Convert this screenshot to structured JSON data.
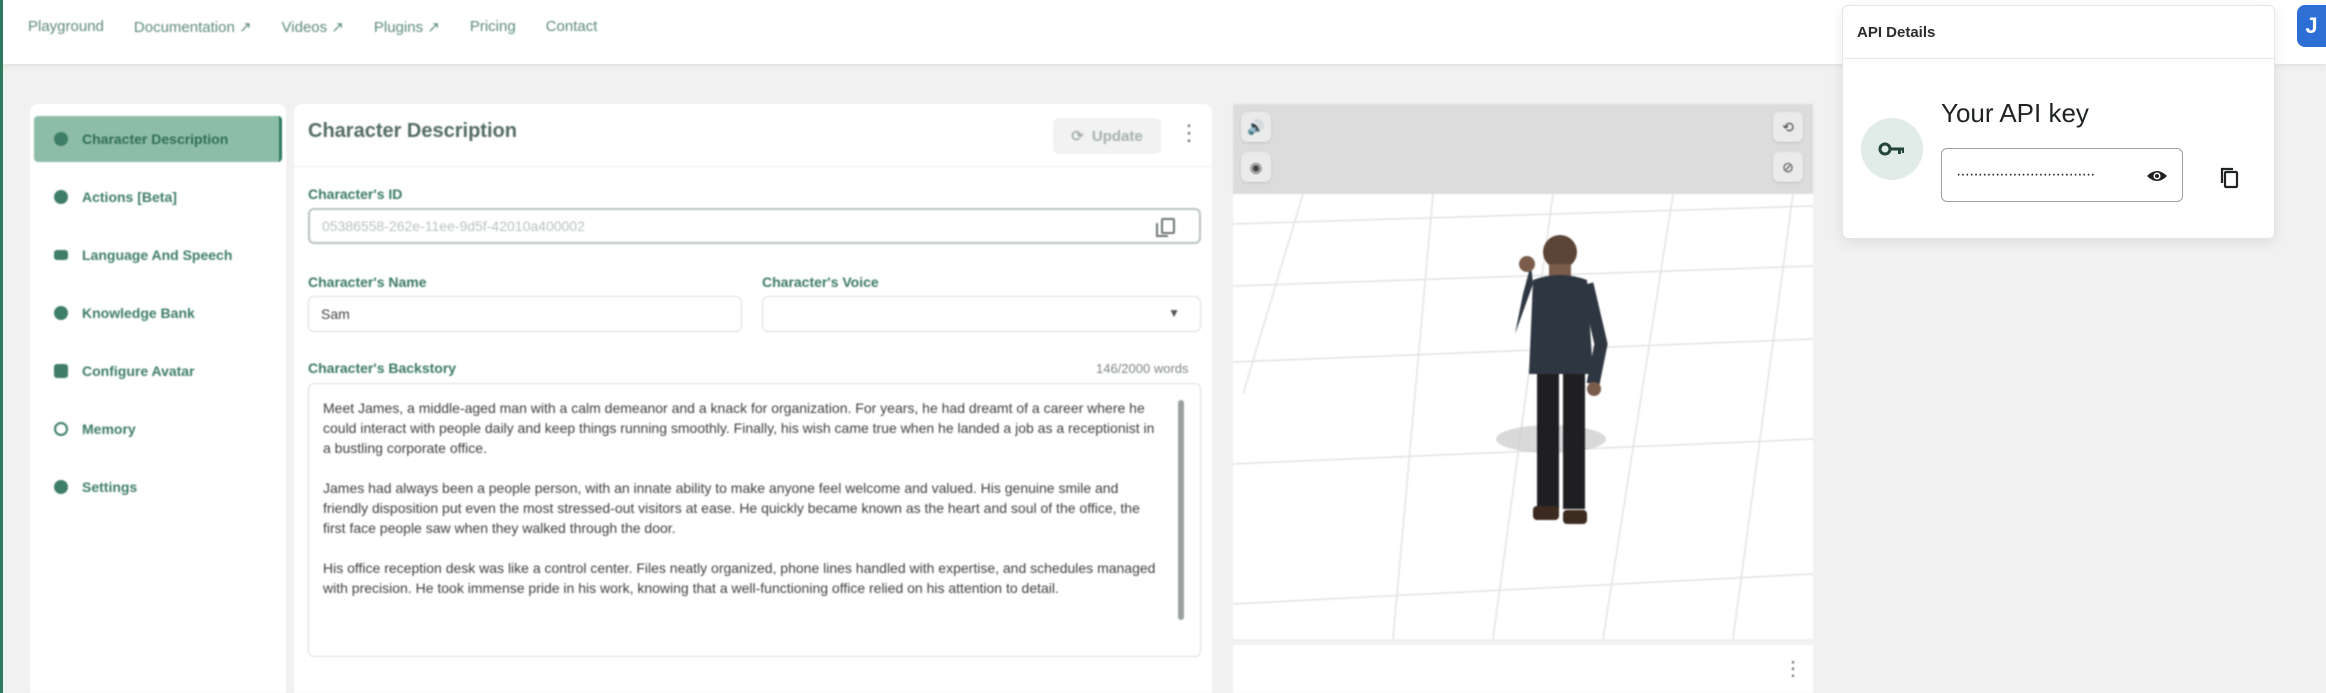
{
  "nav": [
    {
      "label": "Playground"
    },
    {
      "label": "Documentation ↗"
    },
    {
      "label": "Videos ↗"
    },
    {
      "label": "Plugins ↗"
    },
    {
      "label": "Pricing"
    },
    {
      "label": "Contact"
    }
  ],
  "sidebar": {
    "items": [
      {
        "label": "Character Description",
        "icon": "person-icon",
        "active": true
      },
      {
        "label": "Actions [Beta]",
        "icon": "run-icon",
        "active": false
      },
      {
        "label": "Language And Speech",
        "icon": "keyboard-icon",
        "active": false
      },
      {
        "label": "Knowledge Bank",
        "icon": "bulb-icon",
        "active": false
      },
      {
        "label": "Configure Avatar",
        "icon": "avatar-icon",
        "active": false
      },
      {
        "label": "Memory",
        "icon": "history-icon",
        "active": false
      },
      {
        "label": "Settings",
        "icon": "gear-icon",
        "active": false
      }
    ]
  },
  "panel": {
    "title": "Character Description",
    "update_label": "Update",
    "character_id_label": "Character's ID",
    "character_id_value": "05386558-262e-11ee-9d5f-42010a400002",
    "character_name_label": "Character's Name",
    "character_name_value": "Sam",
    "character_voice_label": "Character's Voice",
    "character_voice_value": "",
    "backstory_label": "Character's Backstory",
    "word_count": "146/2000 words",
    "backstory_paragraphs": [
      "Meet James, a middle-aged man with a calm demeanor and a knack for organization. For years, he had dreamt of a career where he could interact with people daily and keep things running smoothly. Finally, his wish came true when he landed a job as a receptionist in a bustling corporate office.",
      "James had always been a people person, with an innate ability to make anyone feel welcome and valued. His genuine smile and friendly disposition put even the most stressed-out visitors at ease. He quickly became known as the heart and soul of the office, the first face people saw when they walked through the door.",
      "His office reception desk was like a control center. Files neatly organized, phone lines handled with expertise, and schedules managed with precision. He took immense pride in his work, knowing that a well-functioning office relied on his attention to detail."
    ]
  },
  "api_card": {
    "header": "API Details",
    "title": "Your API key",
    "masked_key": "································"
  },
  "user_avatar_initial": "J",
  "colors": {
    "accent": "#2f7a5d",
    "sidebar_active_bg": "#8dbda8",
    "avatar_button": "#2e6fd6"
  }
}
